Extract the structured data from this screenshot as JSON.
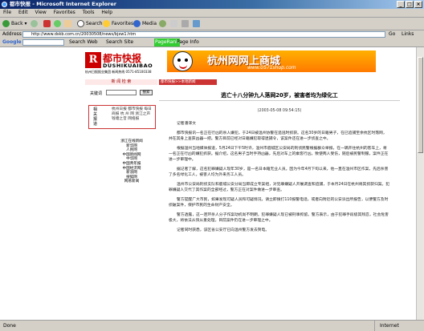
{
  "window": {
    "title": "都市快报 - Microsoft Internet Explorer"
  },
  "menubar": [
    "File",
    "Edit",
    "View",
    "Favorites",
    "Tools",
    "Help"
  ],
  "toolbar": {
    "back": "Back",
    "search": "Search",
    "favorites": "Favorites",
    "media": "Media"
  },
  "addressbar": {
    "label": "Address",
    "url": "http://www.dskb.com.cn/20030508/news/bjxw1.htm",
    "go": "Go",
    "links": "Links"
  },
  "googlebar": {
    "label": "Google -",
    "search_web": "Search Web",
    "search_site": "Search Site",
    "pagerank": "PageRank",
    "page_info": "Page Info"
  },
  "status": {
    "left": "Done",
    "right": "Internet"
  },
  "page": {
    "logo_cn": "都市快报",
    "logo_en": "DUSHIKUAIBAO",
    "logo_sub": "杭州日报报业集团 新闻热线 0571-85100338",
    "banner_title": "杭州网网上商城",
    "banner_url": "www.0571shop.com",
    "left_header": "新 闻 检 索",
    "keyword_label": "关键词",
    "search_button": "搜索",
    "related_label": "相关报道",
    "related_items": "杭州日报 都市快报 每日商报 杭 州 网 浙江之声 钱塘之音 网络报",
    "links": [
      "浙江在线新闻",
      "新华网",
      "人民网",
      "中国新闻网",
      "中华网",
      "中国青年报",
      "中国经济网",
      "新浪网",
      "搜狐网",
      "网易新闻"
    ],
    "breadcrumb": "都市快报>>本地新闻",
    "article_title": "逃亡十八分钟九人落网20岁，被害者均为绿化工",
    "article_date": "(2003-05-08 09:54:15)",
    "paragraphs": [
      "记者潘译文",
      "都市快报讯一名正在行凶的杀人嫌犯，于24日被温州协警在追逃时抓获。这名30岁的日籍男子，在已追捕至余杭区时落网，并在其身上查获凶器一把。警方目前已经对日籍嫌犯取得逮捕令，该案件还在进一步侦查之中。",
      "根据温州当地媒体报道，5月24日下午5时许，温州市鹿城区公安局的刑侦民警根据群众举报，在一辆开往杭州的客车上，将一名正在行凶的嫌犯抓获。据介绍，这名男子当时手持凶器，先后对车上的乘客行凶，致使两人受伤，随后被民警制服，案件正在进一步审理中。",
      "据记者了解，这名犯罪嫌疑人现年30岁，是一名日本籍无业人员。因为今年4月下旬以来，他一直在温州市区作案，先后杀害了多名绿化工人，被害人均为外来务工人员。",
      "温州市公安局刑侦支队和鹿城公安分局当即成立专案组，对犯罪嫌疑人开展调查和追捕，于本月24日在杭州将其抓获归案。犯罪嫌疑人交代了其作案的全部经过，警方正在对案件做进一步审查。",
      "警方提醒广大市民，如果发现可疑人员和可疑情况，请立即拨打110报警电话，或者向附近的公安派出所报告，以便警方及时侦破案件，保护市民的生命财产安全。",
      "警方透露，这一连环杀人分子作案动机尚不明朗，犯罪嫌疑人现已被刑事拘留。警方表示，由于犯罪手段极其残忍，社会危害极大，将依法从快从重处理，目前案件仍在进一步审理之中。",
      "记者同时获悉，该区省公安厅已向温州警方发去贺电。"
    ]
  }
}
